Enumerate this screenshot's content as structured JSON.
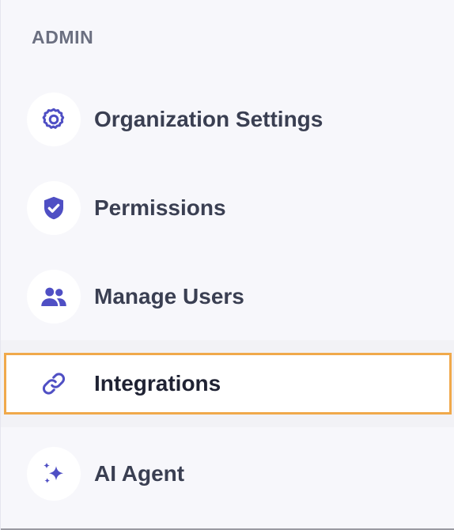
{
  "sidebar": {
    "section_title": "ADMIN",
    "accent_color": "#4f4fc4",
    "highlight_color": "#f0a94b",
    "items": [
      {
        "label": "Organization Settings",
        "icon": "gear-icon",
        "active": false
      },
      {
        "label": "Permissions",
        "icon": "shield-check-icon",
        "active": false
      },
      {
        "label": "Manage Users",
        "icon": "users-icon",
        "active": false
      },
      {
        "label": "Integrations",
        "icon": "link-icon",
        "active": true
      },
      {
        "label": "AI Agent",
        "icon": "sparkles-icon",
        "active": false
      }
    ]
  }
}
